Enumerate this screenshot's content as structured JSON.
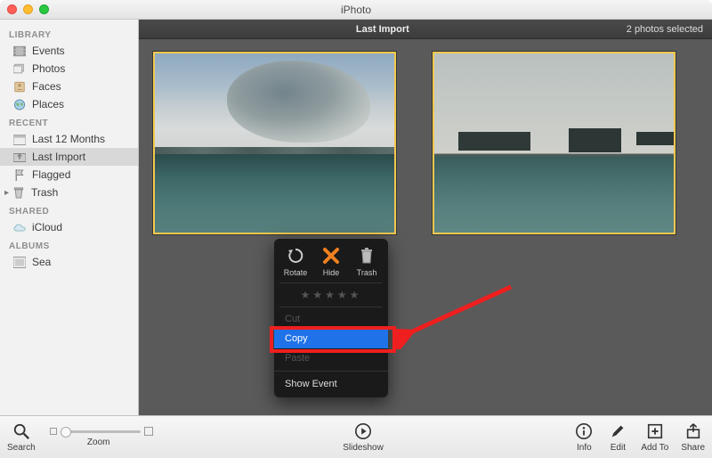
{
  "app_title": "iPhoto",
  "sidebar": {
    "sections": {
      "library": "LIBRARY",
      "recent": "RECENT",
      "shared": "SHARED",
      "albums": "ALBUMS"
    },
    "items": {
      "events": "Events",
      "photos": "Photos",
      "faces": "Faces",
      "places": "Places",
      "last12": "Last 12 Months",
      "last_import": "Last Import",
      "flagged": "Flagged",
      "trash": "Trash",
      "icloud": "iCloud",
      "sea": "Sea"
    }
  },
  "header": {
    "title": "Last Import",
    "selection": "2 photos selected"
  },
  "context_menu": {
    "rotate": "Rotate",
    "hide": "Hide",
    "trash": "Trash",
    "cut": "Cut",
    "copy": "Copy",
    "paste": "Paste",
    "show_event": "Show Event"
  },
  "toolbar": {
    "search": "Search",
    "zoom": "Zoom",
    "slideshow": "Slideshow",
    "info": "Info",
    "edit": "Edit",
    "add_to": "Add To",
    "share": "Share"
  },
  "colors": {
    "selection_yellow": "#f3c94e",
    "highlight_red": "#ef1f1f",
    "menu_sel_blue": "#1f72e8"
  }
}
